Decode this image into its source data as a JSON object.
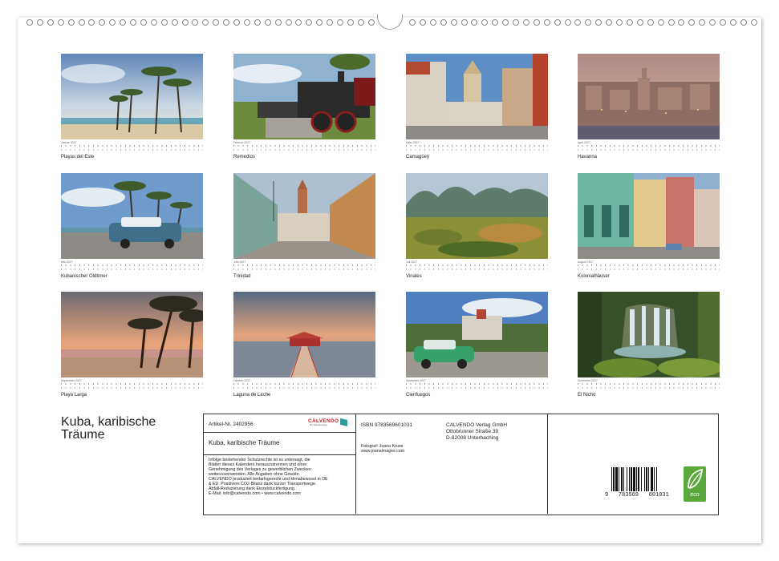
{
  "calendar": {
    "title_line1": "Kuba, karibische",
    "title_line2": "Träume"
  },
  "months": [
    {
      "month": "Januar 2027",
      "caption": "Playas del Este",
      "scene": "beach-palms"
    },
    {
      "month": "Februar 2027",
      "caption": "Remedios",
      "scene": "locomotive"
    },
    {
      "month": "März 2027",
      "caption": "Camagüey",
      "scene": "street-church"
    },
    {
      "month": "April 2027",
      "caption": "Havanna",
      "scene": "city-dusk"
    },
    {
      "month": "Mai 2027",
      "caption": "Kubanischer Oldtimer",
      "scene": "oldtimer-palms"
    },
    {
      "month": "Juni 2027",
      "caption": "Trinidad",
      "scene": "colonial-street"
    },
    {
      "month": "Juli 2027",
      "caption": "Vinales",
      "scene": "valley"
    },
    {
      "month": "August 2027",
      "caption": "Kolonialhäuser",
      "scene": "colonnade"
    },
    {
      "month": "September 2027",
      "caption": "Playa Larga",
      "scene": "sunset-palms"
    },
    {
      "month": "Oktober 2027",
      "caption": "Laguna de Leche",
      "scene": "pier"
    },
    {
      "month": "November 2027",
      "caption": "Cienfuegos",
      "scene": "green-car"
    },
    {
      "month": "Dezember 2027",
      "caption": "El Nicho",
      "scene": "waterfall"
    }
  ],
  "info": {
    "article": "Artikel-Nr. 2402956",
    "publisher_logo": "CALVENDO",
    "publisher_logo_sub": "Der Kalenderverlag",
    "title": "Kuba, karibische Träume",
    "legal_lines": [
      "Infolge bestehender Schutzrechte ist es untersagt, die",
      "Blätter dieses Kalenders herauszutrennen und ohne",
      "Genehmigung des Verlages zu gewerblichen Zwecken",
      "weiterzuverwenden. Alle Angaben ohne Gewähr.",
      "CALVENDO produziert bedarfsgerecht und klimabewusst in DE",
      "& EU. Positivere CO2-Bilanz dank kurzer Transportwege.",
      "Abfall-Reduzierung dank Einzelstückfertigung.",
      "E-Mail: info@calvendo.com • www.calvendo.com"
    ],
    "isbn": "ISBN 9783569601031",
    "photographer": "Fotograf: Joana Kruse",
    "photographer_web": "www.joanaimages.com",
    "publisher_name": "CALVENDO Verlag GmbH",
    "publisher_street": "Ottobrunner Straße 39",
    "publisher_city": "D-82008 Unterhaching",
    "barcode_digits": "9   783569   601031",
    "eco_label": "eco"
  }
}
